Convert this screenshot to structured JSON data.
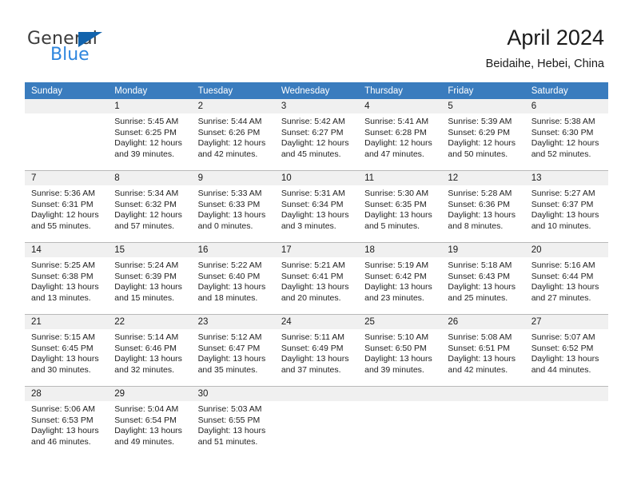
{
  "brand": {
    "name_part1": "General",
    "name_part2": "Blue",
    "accent_color": "#2e86de",
    "triangle_color": "#1263ac"
  },
  "header": {
    "title": "April 2024",
    "location": "Beidaihe, Hebei, China"
  },
  "calendar": {
    "header_bg": "#3a7cbe",
    "daynum_bg": "#f0f0f0",
    "weekdays": [
      "Sunday",
      "Monday",
      "Tuesday",
      "Wednesday",
      "Thursday",
      "Friday",
      "Saturday"
    ],
    "weeks": [
      [
        {
          "day": "",
          "empty": true
        },
        {
          "day": "1",
          "sunrise": "Sunrise: 5:45 AM",
          "sunset": "Sunset: 6:25 PM",
          "daylight_line1": "Daylight: 12 hours",
          "daylight_line2": "and 39 minutes."
        },
        {
          "day": "2",
          "sunrise": "Sunrise: 5:44 AM",
          "sunset": "Sunset: 6:26 PM",
          "daylight_line1": "Daylight: 12 hours",
          "daylight_line2": "and 42 minutes."
        },
        {
          "day": "3",
          "sunrise": "Sunrise: 5:42 AM",
          "sunset": "Sunset: 6:27 PM",
          "daylight_line1": "Daylight: 12 hours",
          "daylight_line2": "and 45 minutes."
        },
        {
          "day": "4",
          "sunrise": "Sunrise: 5:41 AM",
          "sunset": "Sunset: 6:28 PM",
          "daylight_line1": "Daylight: 12 hours",
          "daylight_line2": "and 47 minutes."
        },
        {
          "day": "5",
          "sunrise": "Sunrise: 5:39 AM",
          "sunset": "Sunset: 6:29 PM",
          "daylight_line1": "Daylight: 12 hours",
          "daylight_line2": "and 50 minutes."
        },
        {
          "day": "6",
          "sunrise": "Sunrise: 5:38 AM",
          "sunset": "Sunset: 6:30 PM",
          "daylight_line1": "Daylight: 12 hours",
          "daylight_line2": "and 52 minutes."
        }
      ],
      [
        {
          "day": "7",
          "sunrise": "Sunrise: 5:36 AM",
          "sunset": "Sunset: 6:31 PM",
          "daylight_line1": "Daylight: 12 hours",
          "daylight_line2": "and 55 minutes."
        },
        {
          "day": "8",
          "sunrise": "Sunrise: 5:34 AM",
          "sunset": "Sunset: 6:32 PM",
          "daylight_line1": "Daylight: 12 hours",
          "daylight_line2": "and 57 minutes."
        },
        {
          "day": "9",
          "sunrise": "Sunrise: 5:33 AM",
          "sunset": "Sunset: 6:33 PM",
          "daylight_line1": "Daylight: 13 hours",
          "daylight_line2": "and 0 minutes."
        },
        {
          "day": "10",
          "sunrise": "Sunrise: 5:31 AM",
          "sunset": "Sunset: 6:34 PM",
          "daylight_line1": "Daylight: 13 hours",
          "daylight_line2": "and 3 minutes."
        },
        {
          "day": "11",
          "sunrise": "Sunrise: 5:30 AM",
          "sunset": "Sunset: 6:35 PM",
          "daylight_line1": "Daylight: 13 hours",
          "daylight_line2": "and 5 minutes."
        },
        {
          "day": "12",
          "sunrise": "Sunrise: 5:28 AM",
          "sunset": "Sunset: 6:36 PM",
          "daylight_line1": "Daylight: 13 hours",
          "daylight_line2": "and 8 minutes."
        },
        {
          "day": "13",
          "sunrise": "Sunrise: 5:27 AM",
          "sunset": "Sunset: 6:37 PM",
          "daylight_line1": "Daylight: 13 hours",
          "daylight_line2": "and 10 minutes."
        }
      ],
      [
        {
          "day": "14",
          "sunrise": "Sunrise: 5:25 AM",
          "sunset": "Sunset: 6:38 PM",
          "daylight_line1": "Daylight: 13 hours",
          "daylight_line2": "and 13 minutes."
        },
        {
          "day": "15",
          "sunrise": "Sunrise: 5:24 AM",
          "sunset": "Sunset: 6:39 PM",
          "daylight_line1": "Daylight: 13 hours",
          "daylight_line2": "and 15 minutes."
        },
        {
          "day": "16",
          "sunrise": "Sunrise: 5:22 AM",
          "sunset": "Sunset: 6:40 PM",
          "daylight_line1": "Daylight: 13 hours",
          "daylight_line2": "and 18 minutes."
        },
        {
          "day": "17",
          "sunrise": "Sunrise: 5:21 AM",
          "sunset": "Sunset: 6:41 PM",
          "daylight_line1": "Daylight: 13 hours",
          "daylight_line2": "and 20 minutes."
        },
        {
          "day": "18",
          "sunrise": "Sunrise: 5:19 AM",
          "sunset": "Sunset: 6:42 PM",
          "daylight_line1": "Daylight: 13 hours",
          "daylight_line2": "and 23 minutes."
        },
        {
          "day": "19",
          "sunrise": "Sunrise: 5:18 AM",
          "sunset": "Sunset: 6:43 PM",
          "daylight_line1": "Daylight: 13 hours",
          "daylight_line2": "and 25 minutes."
        },
        {
          "day": "20",
          "sunrise": "Sunrise: 5:16 AM",
          "sunset": "Sunset: 6:44 PM",
          "daylight_line1": "Daylight: 13 hours",
          "daylight_line2": "and 27 minutes."
        }
      ],
      [
        {
          "day": "21",
          "sunrise": "Sunrise: 5:15 AM",
          "sunset": "Sunset: 6:45 PM",
          "daylight_line1": "Daylight: 13 hours",
          "daylight_line2": "and 30 minutes."
        },
        {
          "day": "22",
          "sunrise": "Sunrise: 5:14 AM",
          "sunset": "Sunset: 6:46 PM",
          "daylight_line1": "Daylight: 13 hours",
          "daylight_line2": "and 32 minutes."
        },
        {
          "day": "23",
          "sunrise": "Sunrise: 5:12 AM",
          "sunset": "Sunset: 6:47 PM",
          "daylight_line1": "Daylight: 13 hours",
          "daylight_line2": "and 35 minutes."
        },
        {
          "day": "24",
          "sunrise": "Sunrise: 5:11 AM",
          "sunset": "Sunset: 6:49 PM",
          "daylight_line1": "Daylight: 13 hours",
          "daylight_line2": "and 37 minutes."
        },
        {
          "day": "25",
          "sunrise": "Sunrise: 5:10 AM",
          "sunset": "Sunset: 6:50 PM",
          "daylight_line1": "Daylight: 13 hours",
          "daylight_line2": "and 39 minutes."
        },
        {
          "day": "26",
          "sunrise": "Sunrise: 5:08 AM",
          "sunset": "Sunset: 6:51 PM",
          "daylight_line1": "Daylight: 13 hours",
          "daylight_line2": "and 42 minutes."
        },
        {
          "day": "27",
          "sunrise": "Sunrise: 5:07 AM",
          "sunset": "Sunset: 6:52 PM",
          "daylight_line1": "Daylight: 13 hours",
          "daylight_line2": "and 44 minutes."
        }
      ],
      [
        {
          "day": "28",
          "sunrise": "Sunrise: 5:06 AM",
          "sunset": "Sunset: 6:53 PM",
          "daylight_line1": "Daylight: 13 hours",
          "daylight_line2": "and 46 minutes."
        },
        {
          "day": "29",
          "sunrise": "Sunrise: 5:04 AM",
          "sunset": "Sunset: 6:54 PM",
          "daylight_line1": "Daylight: 13 hours",
          "daylight_line2": "and 49 minutes."
        },
        {
          "day": "30",
          "sunrise": "Sunrise: 5:03 AM",
          "sunset": "Sunset: 6:55 PM",
          "daylight_line1": "Daylight: 13 hours",
          "daylight_line2": "and 51 minutes."
        },
        {
          "day": "",
          "empty": true
        },
        {
          "day": "",
          "empty": true
        },
        {
          "day": "",
          "empty": true
        },
        {
          "day": "",
          "empty": true
        }
      ]
    ]
  }
}
